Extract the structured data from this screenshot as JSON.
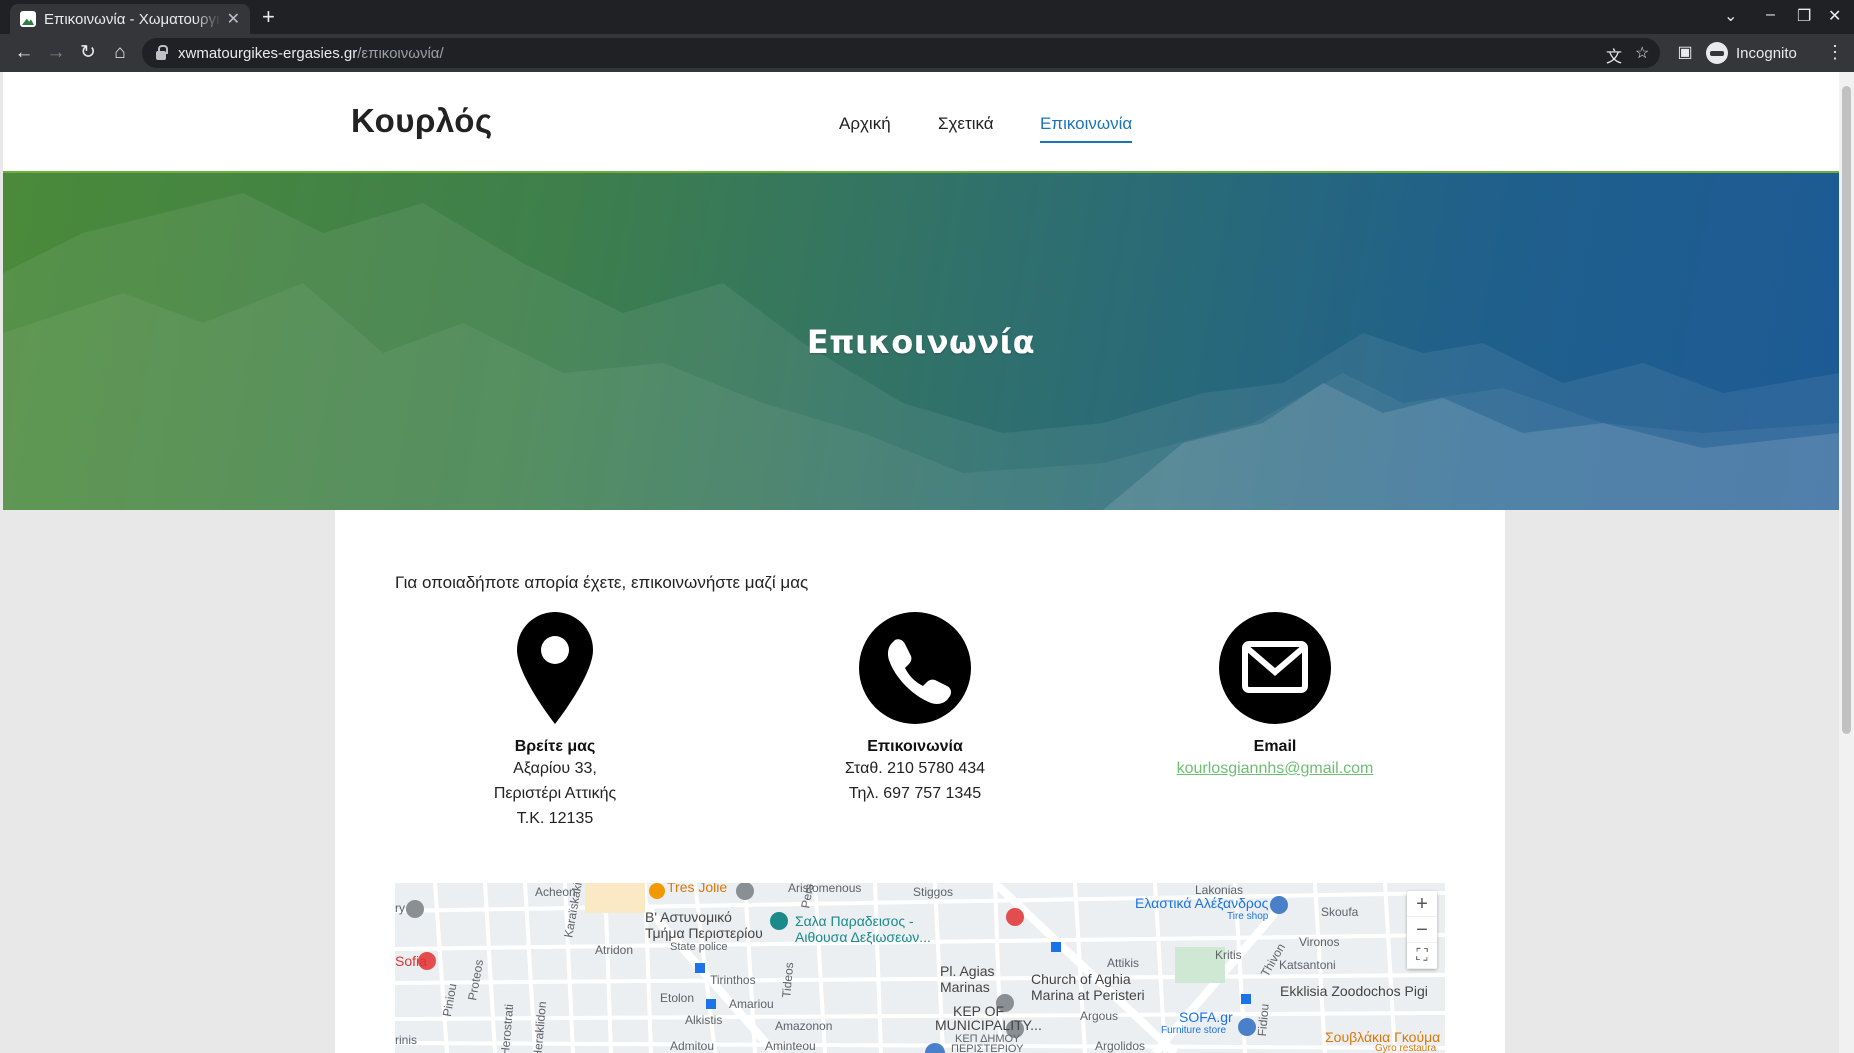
{
  "browser": {
    "tab_title": "Επικοινωνία - Χωματουργικές Εργασίες",
    "url_host": "xwmatourgikes-ergasies.gr",
    "url_path": "/επικοινωνία/",
    "profile_label": "Incognito",
    "icons": [
      "back-icon",
      "forward-icon",
      "reload-icon",
      "home-icon",
      "lock-icon",
      "translate-icon",
      "star-icon",
      "side-panel-icon",
      "incognito-icon",
      "menu-icon"
    ]
  },
  "site": {
    "logo": "Κουρλός",
    "nav": [
      {
        "label": "Αρχική",
        "active": false
      },
      {
        "label": "Σχετικά",
        "active": false
      },
      {
        "label": "Επικοινωνία",
        "active": true
      }
    ],
    "accent_color": "#1b74b8",
    "green_color": "#6fae3a"
  },
  "hero": {
    "title": "Επικοινωνία"
  },
  "contact": {
    "intro": "Για οποιαδήποτε απορία έχετε, επικοινωνήστε μαζί μας",
    "location": {
      "icon": "map-pin-icon",
      "heading": "Βρείτε μας",
      "line1": "Αξαρίου 33,",
      "line2": "Περιστέρι Αττικής",
      "line3": "Τ.Κ. 12135"
    },
    "phone": {
      "icon": "phone-icon",
      "heading": "Επικοινωνία",
      "line1": "Σταθ. 210 5780 434",
      "line2": "Τηλ. 697 757 1345"
    },
    "email": {
      "icon": "envelope-icon",
      "heading": "Email",
      "address": "kourlosgiannhs@gmail.com"
    }
  },
  "map": {
    "labels": {
      "acheon": "Acheon",
      "tres_jolie": "Tres Jolie",
      "aristomenous": "Aristomenous",
      "stiggos": "Stiggos",
      "lakonias": "Lakonias",
      "elastika": "Ελαστικά Αλέξανδρος",
      "tire_shop": "Tire shop",
      "skoufa": "Skoufa",
      "b_astynomiko": "Β' Αστυνομικό",
      "tmima": "Τμήμα Περιστερίου",
      "state_police": "State police",
      "sala": "Σαλα Παραδεισος -",
      "aithousa": "Αιθουσα Δεξιωσεων...",
      "sofia": "Sofia",
      "atridon": "Atridon",
      "attikis": "Attikis",
      "kritis": "Kritis",
      "katsantoni": "Katsantoni",
      "vironos": "Vironos",
      "thivon": "Thivon",
      "tirinthos": "Tirinthos",
      "pl_agias": "Pl. Agias",
      "marinas": "Marinas",
      "church1": "Church of Aghia",
      "church2": "Marina at Peristeri",
      "ekklisia": "Ekklisia Zoodochos Pigi",
      "etolon": "Etolon",
      "amariou": "Amariou",
      "kep1": "KEP OF",
      "kep2": "MUNICIPALITY...",
      "kep3": "ΚΕΠ ΔΗΜΟΥ",
      "kep4": "ΠΕΡΙΣΤΕΡΙΟΥ",
      "argous": "Argous",
      "sofa": "SOFA.gr",
      "furniture": "Furniture store",
      "amazonon": "Amazonon",
      "alkistis": "Alkistis",
      "admitou": "Admitou",
      "aminteou": "Aminteou",
      "argolidos": "Argolidos",
      "souvlakia": "Σουβλάκια Γκούμα",
      "gyro": "Gyro restaura",
      "piniou": "Piniou",
      "proteos": "Proteos",
      "karaiskaki": "Karaïskaki",
      "tideos": "Tideos",
      "fidiou": "Fidiou",
      "herostrati": "Herostrati",
      "eraklidon": "Heraklidon",
      "rinis": "rinis",
      "ry": "ry",
      "pers": "Pers"
    },
    "zoom_in": "+",
    "zoom_out": "−",
    "fullscreen_icon": "fullscreen-icon"
  }
}
